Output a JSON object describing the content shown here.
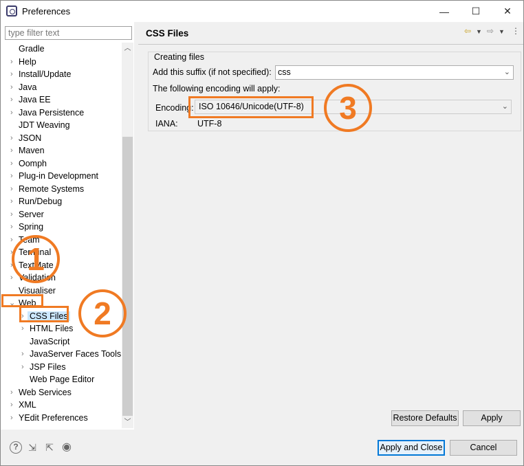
{
  "window": {
    "title": "Preferences",
    "minimize": "—",
    "maximize": "☐",
    "close": "✕"
  },
  "filter": {
    "placeholder": "type filter text",
    "value": ""
  },
  "tree": {
    "items": [
      {
        "label": "Gradle"
      },
      {
        "label": "Help"
      },
      {
        "label": "Install/Update"
      },
      {
        "label": "Java"
      },
      {
        "label": "Java EE"
      },
      {
        "label": "Java Persistence"
      },
      {
        "label": "JDT Weaving"
      },
      {
        "label": "JSON"
      },
      {
        "label": "Maven"
      },
      {
        "label": "Oomph"
      },
      {
        "label": "Plug-in Development"
      },
      {
        "label": "Remote Systems"
      },
      {
        "label": "Run/Debug"
      },
      {
        "label": "Server"
      },
      {
        "label": "Spring"
      },
      {
        "label": "Team"
      },
      {
        "label": "Terminal"
      },
      {
        "label": "TextMate"
      },
      {
        "label": "Validation"
      },
      {
        "label": "Visualiser"
      },
      {
        "label": "Web"
      },
      {
        "label": "CSS Files"
      },
      {
        "label": "HTML Files"
      },
      {
        "label": "JavaScript"
      },
      {
        "label": "JavaServer Faces Tools"
      },
      {
        "label": "JSP Files"
      },
      {
        "label": "Web Page Editor"
      },
      {
        "label": "Web Services"
      },
      {
        "label": "XML"
      },
      {
        "label": "YEdit Preferences"
      }
    ]
  },
  "page": {
    "title": "CSS Files",
    "group_title": "Creating files",
    "suffix_label": "Add this suffix (if not specified):",
    "suffix_value": "css",
    "encoding_intro": "The following encoding will apply:",
    "encoding_label": "Encoding:",
    "encoding_value": "ISO 10646/Unicode(UTF-8)",
    "iana_label": "IANA:",
    "iana_value": "UTF-8",
    "restore_defaults": "Restore Defaults",
    "apply": "Apply"
  },
  "footer": {
    "apply_and_close": "Apply and Close",
    "cancel": "Cancel"
  },
  "annotations": {
    "one": "1",
    "two": "2",
    "three": "3"
  },
  "colors": {
    "annotation": "#f07a23",
    "selection": "#cce8ff",
    "default_button_border": "#0078d7"
  }
}
